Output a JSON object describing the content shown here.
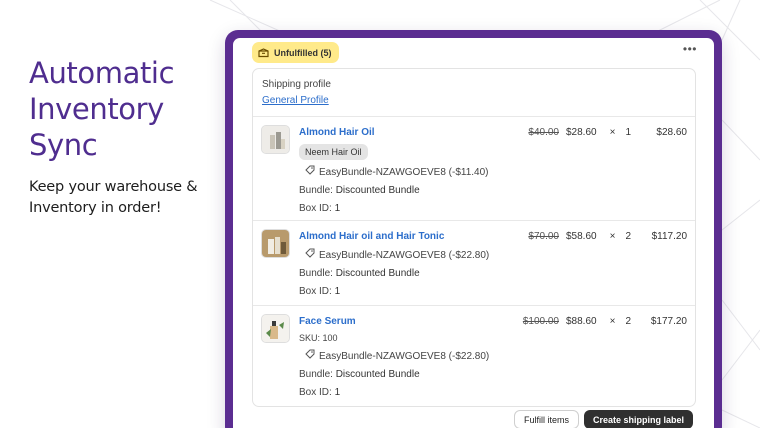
{
  "hero": {
    "title": "Automatic Inventory Sync",
    "subtitle": "Keep your warehouse & Inventory in order!"
  },
  "colors": {
    "accent": "#5b2d91",
    "link": "#2c6ecb",
    "badge": "#ffea8a"
  },
  "order": {
    "status_badge": "Unfulfilled (5)",
    "status_icon": "package-icon",
    "more_label": "•••",
    "shipping_profile_label": "Shipping profile",
    "shipping_profile_link": "General Profile",
    "items": [
      {
        "name": "Almond Hair Oil",
        "variant": "Neem Hair Oil",
        "discount": "EasyBundle-NZAWGOEVE8 (-$11.40)",
        "bundle_label": "Bundle:",
        "bundle_value": "Discounted Bundle",
        "box_label": "Box ID:",
        "box_value": "1",
        "original_price": "$40.00",
        "price": "$28.60",
        "times": "×",
        "quantity": "1",
        "total": "$28.60"
      },
      {
        "name": "Almond Hair oil and Hair Tonic",
        "discount": "EasyBundle-NZAWGOEVE8 (-$22.80)",
        "bundle_label": "Bundle:",
        "bundle_value": "Discounted Bundle",
        "box_label": "Box ID:",
        "box_value": "1",
        "original_price": "$70.00",
        "price": "$58.60",
        "times": "×",
        "quantity": "2",
        "total": "$117.20"
      },
      {
        "name": "Face Serum",
        "sku": "SKU: 100",
        "discount": "EasyBundle-NZAWGOEVE8 (-$22.80)",
        "bundle_label": "Bundle:",
        "bundle_value": "Discounted Bundle",
        "box_label": "Box ID:",
        "box_value": "1",
        "original_price": "$100.00",
        "price": "$88.60",
        "times": "×",
        "quantity": "2",
        "total": "$177.20"
      }
    ],
    "fulfill_button": "Fulfill items",
    "shipping_label_button": "Create shipping label"
  }
}
